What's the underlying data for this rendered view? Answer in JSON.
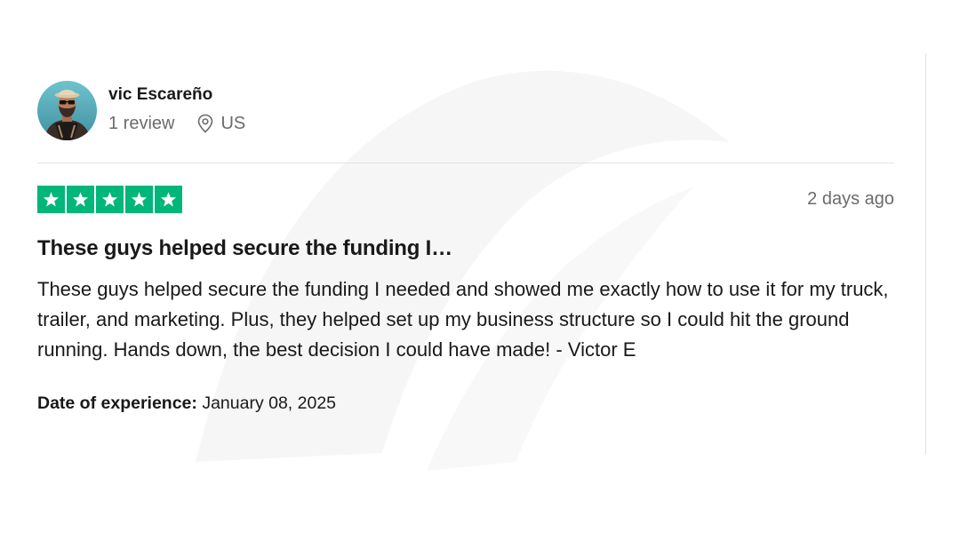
{
  "reviewer": {
    "name": "vic Escareño",
    "review_count": "1 review",
    "country": "US"
  },
  "review": {
    "rating": 5,
    "max_rating": 5,
    "time_ago": "2 days ago",
    "title": "These guys helped secure the funding I…",
    "body": "These guys helped secure the funding I needed and showed me exactly how to use it for my truck, trailer, and marketing. Plus, they helped set up my business structure so I could hit the ground running. Hands down, the best decision I could have made! - Victor E",
    "experience_label": "Date of experience:",
    "experience_date": "January 08, 2025"
  },
  "colors": {
    "star_green": "#00b67a",
    "muted_text": "#6b6b6b",
    "main_text": "#191919"
  },
  "icons": {
    "location": "location-pin-icon",
    "star": "star-icon"
  }
}
